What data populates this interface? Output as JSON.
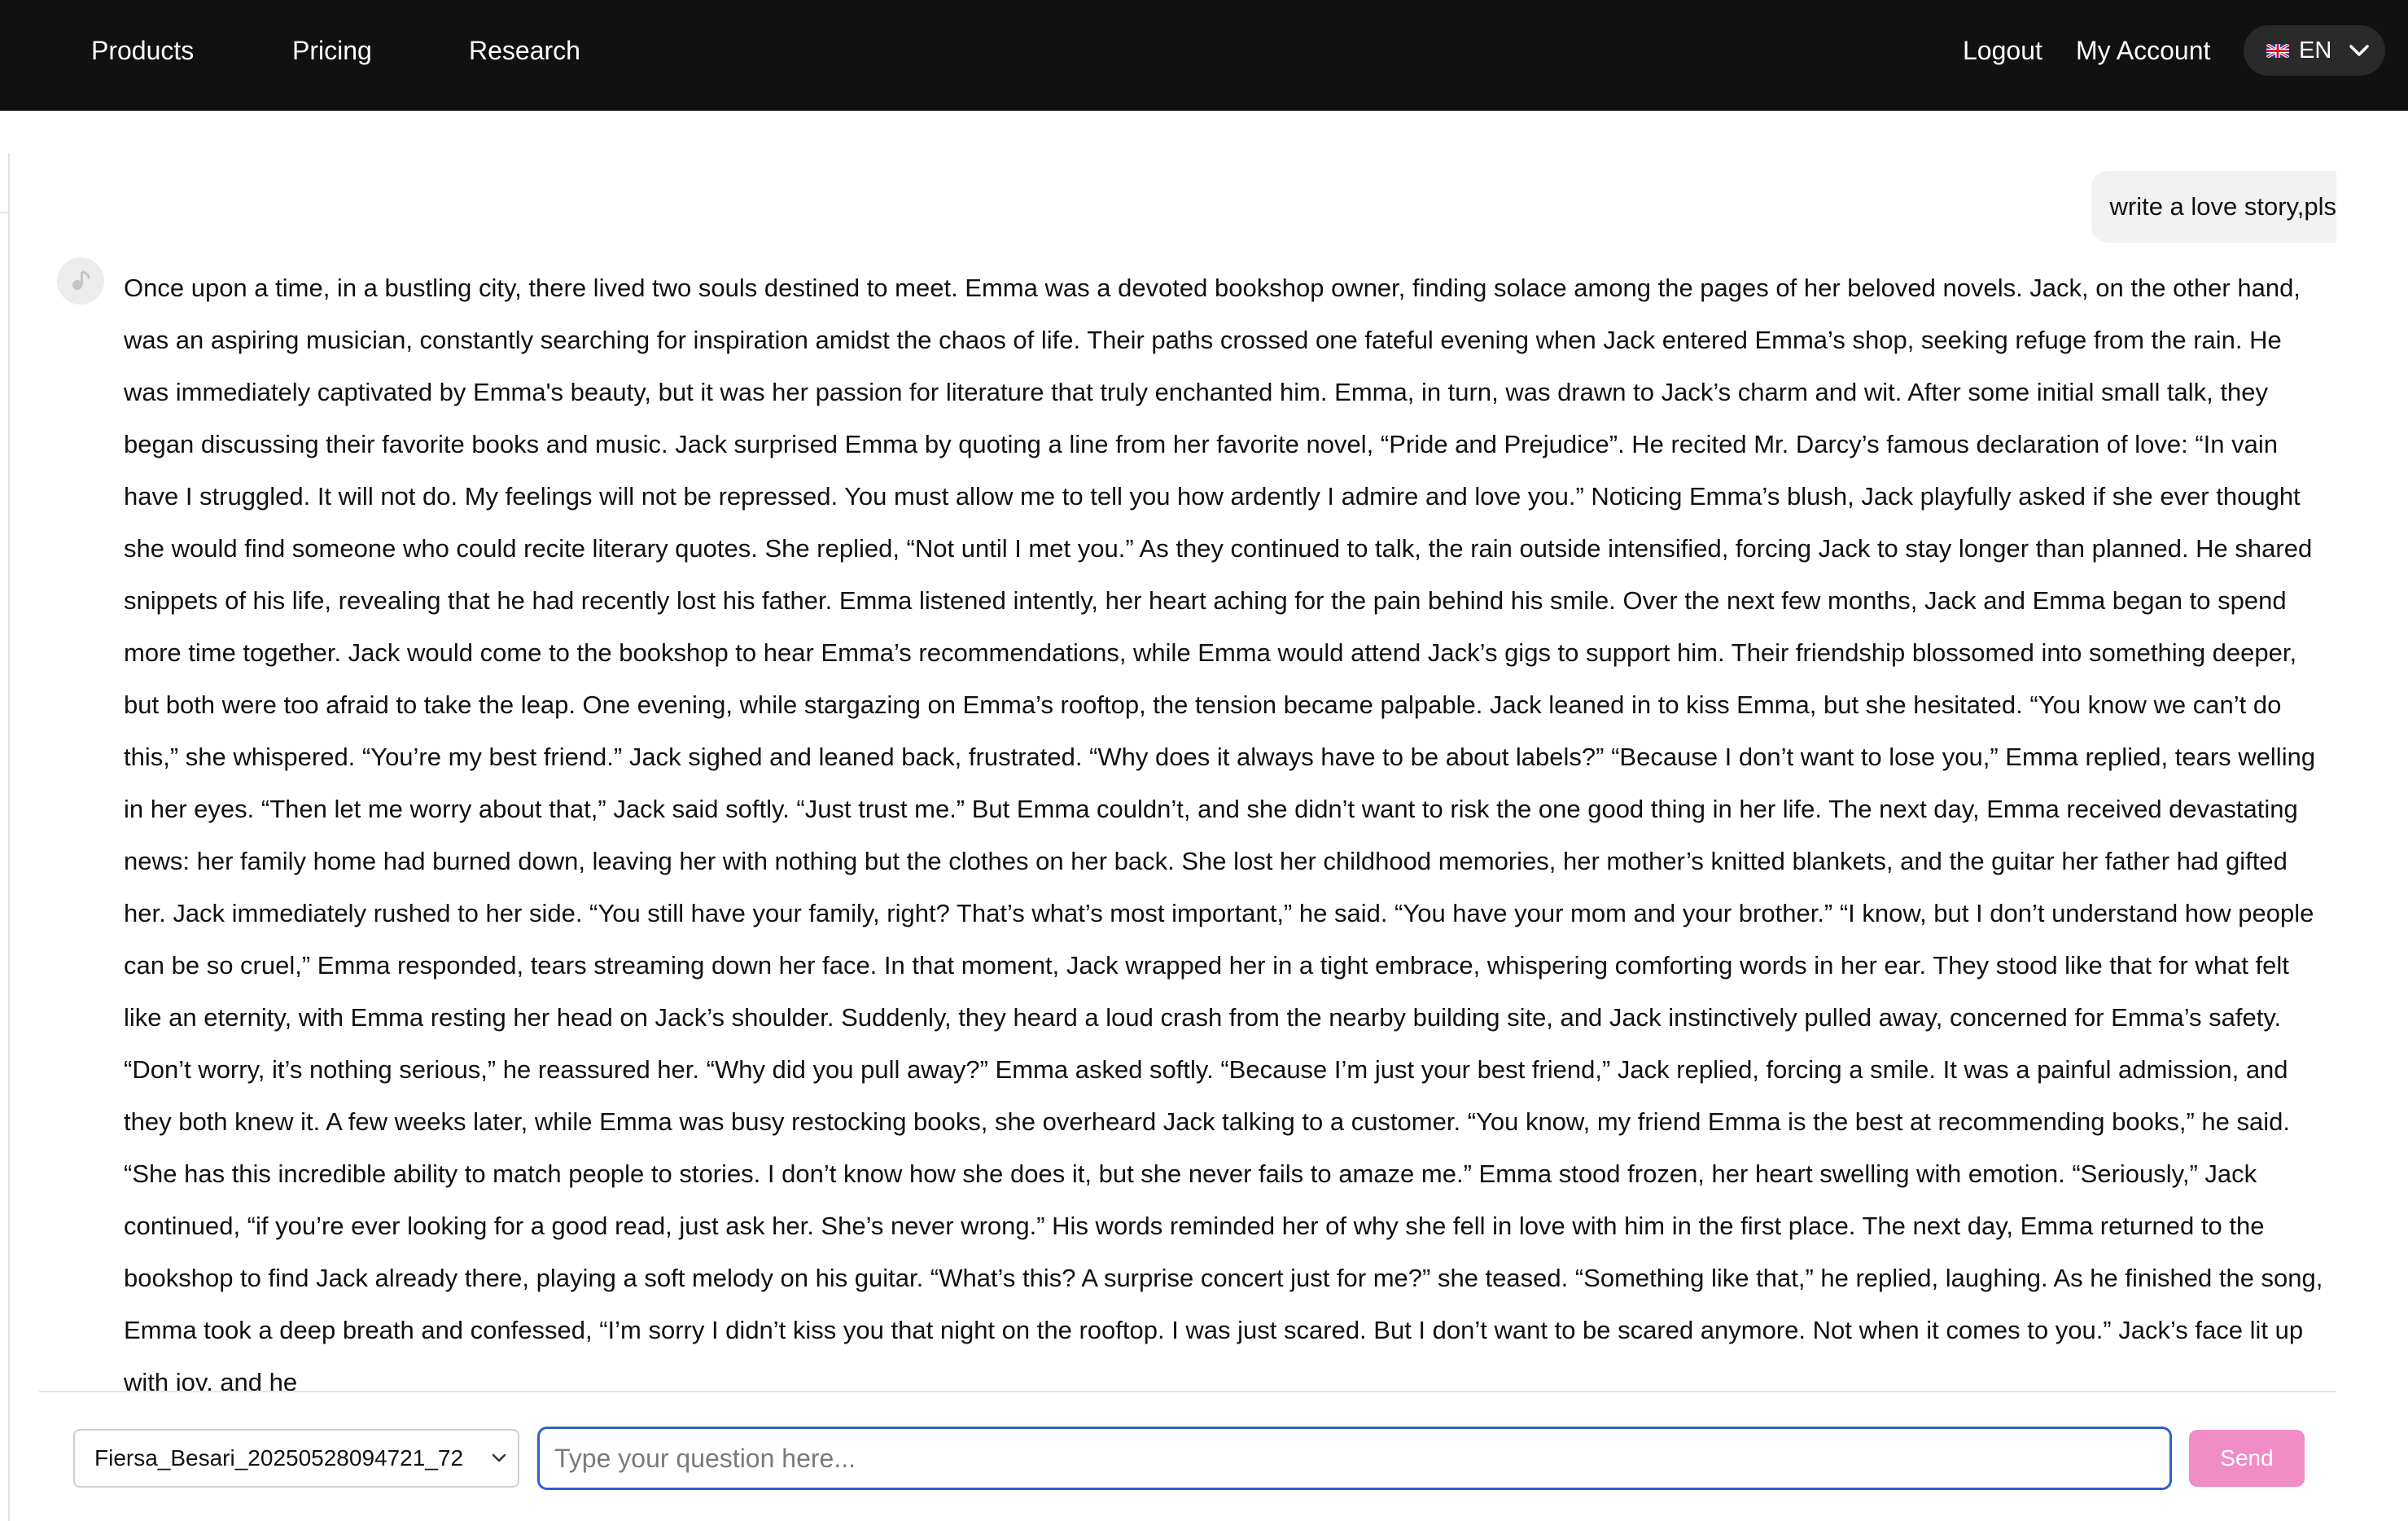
{
  "nav": {
    "links": [
      "Products",
      "Pricing",
      "Research"
    ],
    "logout_label": "Logout",
    "account_label": "My Account",
    "language": {
      "flag_icon": "uk-flag-icon",
      "code": "EN",
      "chevron_icon": "chevron-down-icon"
    }
  },
  "chat": {
    "user_message": "write a love story,pls",
    "assistant_avatar_icon": "music-note-icon",
    "assistant_message": "Once upon a time, in a bustling city, there lived two souls destined to meet. Emma was a devoted bookshop owner, finding solace among the pages of her beloved novels. Jack, on the other hand, was an aspiring musician, constantly searching for inspiration amidst the chaos of life. Their paths crossed one fateful evening when Jack entered Emma’s shop, seeking refuge from the rain. He was immediately captivated by Emma's beauty, but it was her passion for literature that truly enchanted him. Emma, in turn, was drawn to Jack’s charm and wit. After some initial small talk, they began discussing their favorite books and music. Jack surprised Emma by quoting a line from her favorite novel, “Pride and Prejudice”. He recited Mr. Darcy’s famous declaration of love: “In vain have I struggled. It will not do. My feelings will not be repressed. You must allow me to tell you how ardently I admire and love you.” Noticing Emma’s blush, Jack playfully asked if she ever thought she would find someone who could recite literary quotes. She replied, “Not until I met you.” As they continued to talk, the rain outside intensified, forcing Jack to stay longer than planned. He shared snippets of his life, revealing that he had recently lost his father. Emma listened intently, her heart aching for the pain behind his smile. Over the next few months, Jack and Emma began to spend more time together. Jack would come to the bookshop to hear Emma’s recommendations, while Emma would attend Jack’s gigs to support him. Their friendship blossomed into something deeper, but both were too afraid to take the leap. One evening, while stargazing on Emma’s rooftop, the tension became palpable. Jack leaned in to kiss Emma, but she hesitated. “You know we can’t do this,” she whispered. “You’re my best friend.” Jack sighed and leaned back, frustrated. “Why does it always have to be about labels?” “Because I don’t want to lose you,” Emma replied, tears welling in her eyes. “Then let me worry about that,” Jack said softly. “Just trust me.” But Emma couldn’t, and she didn’t want to risk the one good thing in her life. The next day, Emma received devastating news: her family home had burned down, leaving her with nothing but the clothes on her back. She lost her childhood memories, her mother’s knitted blankets, and the guitar her father had gifted her. Jack immediately rushed to her side. “You still have your family, right? That’s what’s most important,” he said. “You have your mom and your brother.” “I know, but I don’t understand how people can be so cruel,” Emma responded, tears streaming down her face. In that moment, Jack wrapped her in a tight embrace, whispering comforting words in her ear. They stood like that for what felt like an eternity, with Emma resting her head on Jack’s shoulder. Suddenly, they heard a loud crash from the nearby building site, and Jack instinctively pulled away, concerned for Emma’s safety. “Don’t worry, it’s nothing serious,” he reassured her. “Why did you pull away?” Emma asked softly. “Because I’m just your best friend,” Jack replied, forcing a smile. It was a painful admission, and they both knew it. A few weeks later, while Emma was busy restocking books, she overheard Jack talking to a customer. “You know, my friend Emma is the best at recommending books,” he said. “She has this incredible ability to match people to stories. I don’t know how she does it, but she never fails to amaze me.” Emma stood frozen, her heart swelling with emotion. “Seriously,” Jack continued, “if you’re ever looking for a good read, just ask her. She’s never wrong.” His words reminded her of why she fell in love with him in the first place. The next day, Emma returned to the bookshop to find Jack already there, playing a soft melody on his guitar. “What’s this? A surprise concert just for me?” she teased. “Something like that,” he replied, laughing. As he finished the song, Emma took a deep breath and confessed, “I’m sorry I didn’t kiss you that night on the rooftop. I was just scared. But I don’t want to be scared anymore. Not when it comes to you.” Jack’s face lit up with joy, and he"
  },
  "composer": {
    "selected_document": "Fiersa_Besari_20250528094721_72",
    "select_chevron_icon": "chevron-down-icon",
    "input_value": "",
    "input_placeholder": "Type your question here...",
    "send_label": "Send"
  },
  "colors": {
    "topbar": "#111111",
    "send_button": "#f08cc6",
    "input_focus_border": "#2f5fd0",
    "user_bubble": "#f2f2f2"
  }
}
